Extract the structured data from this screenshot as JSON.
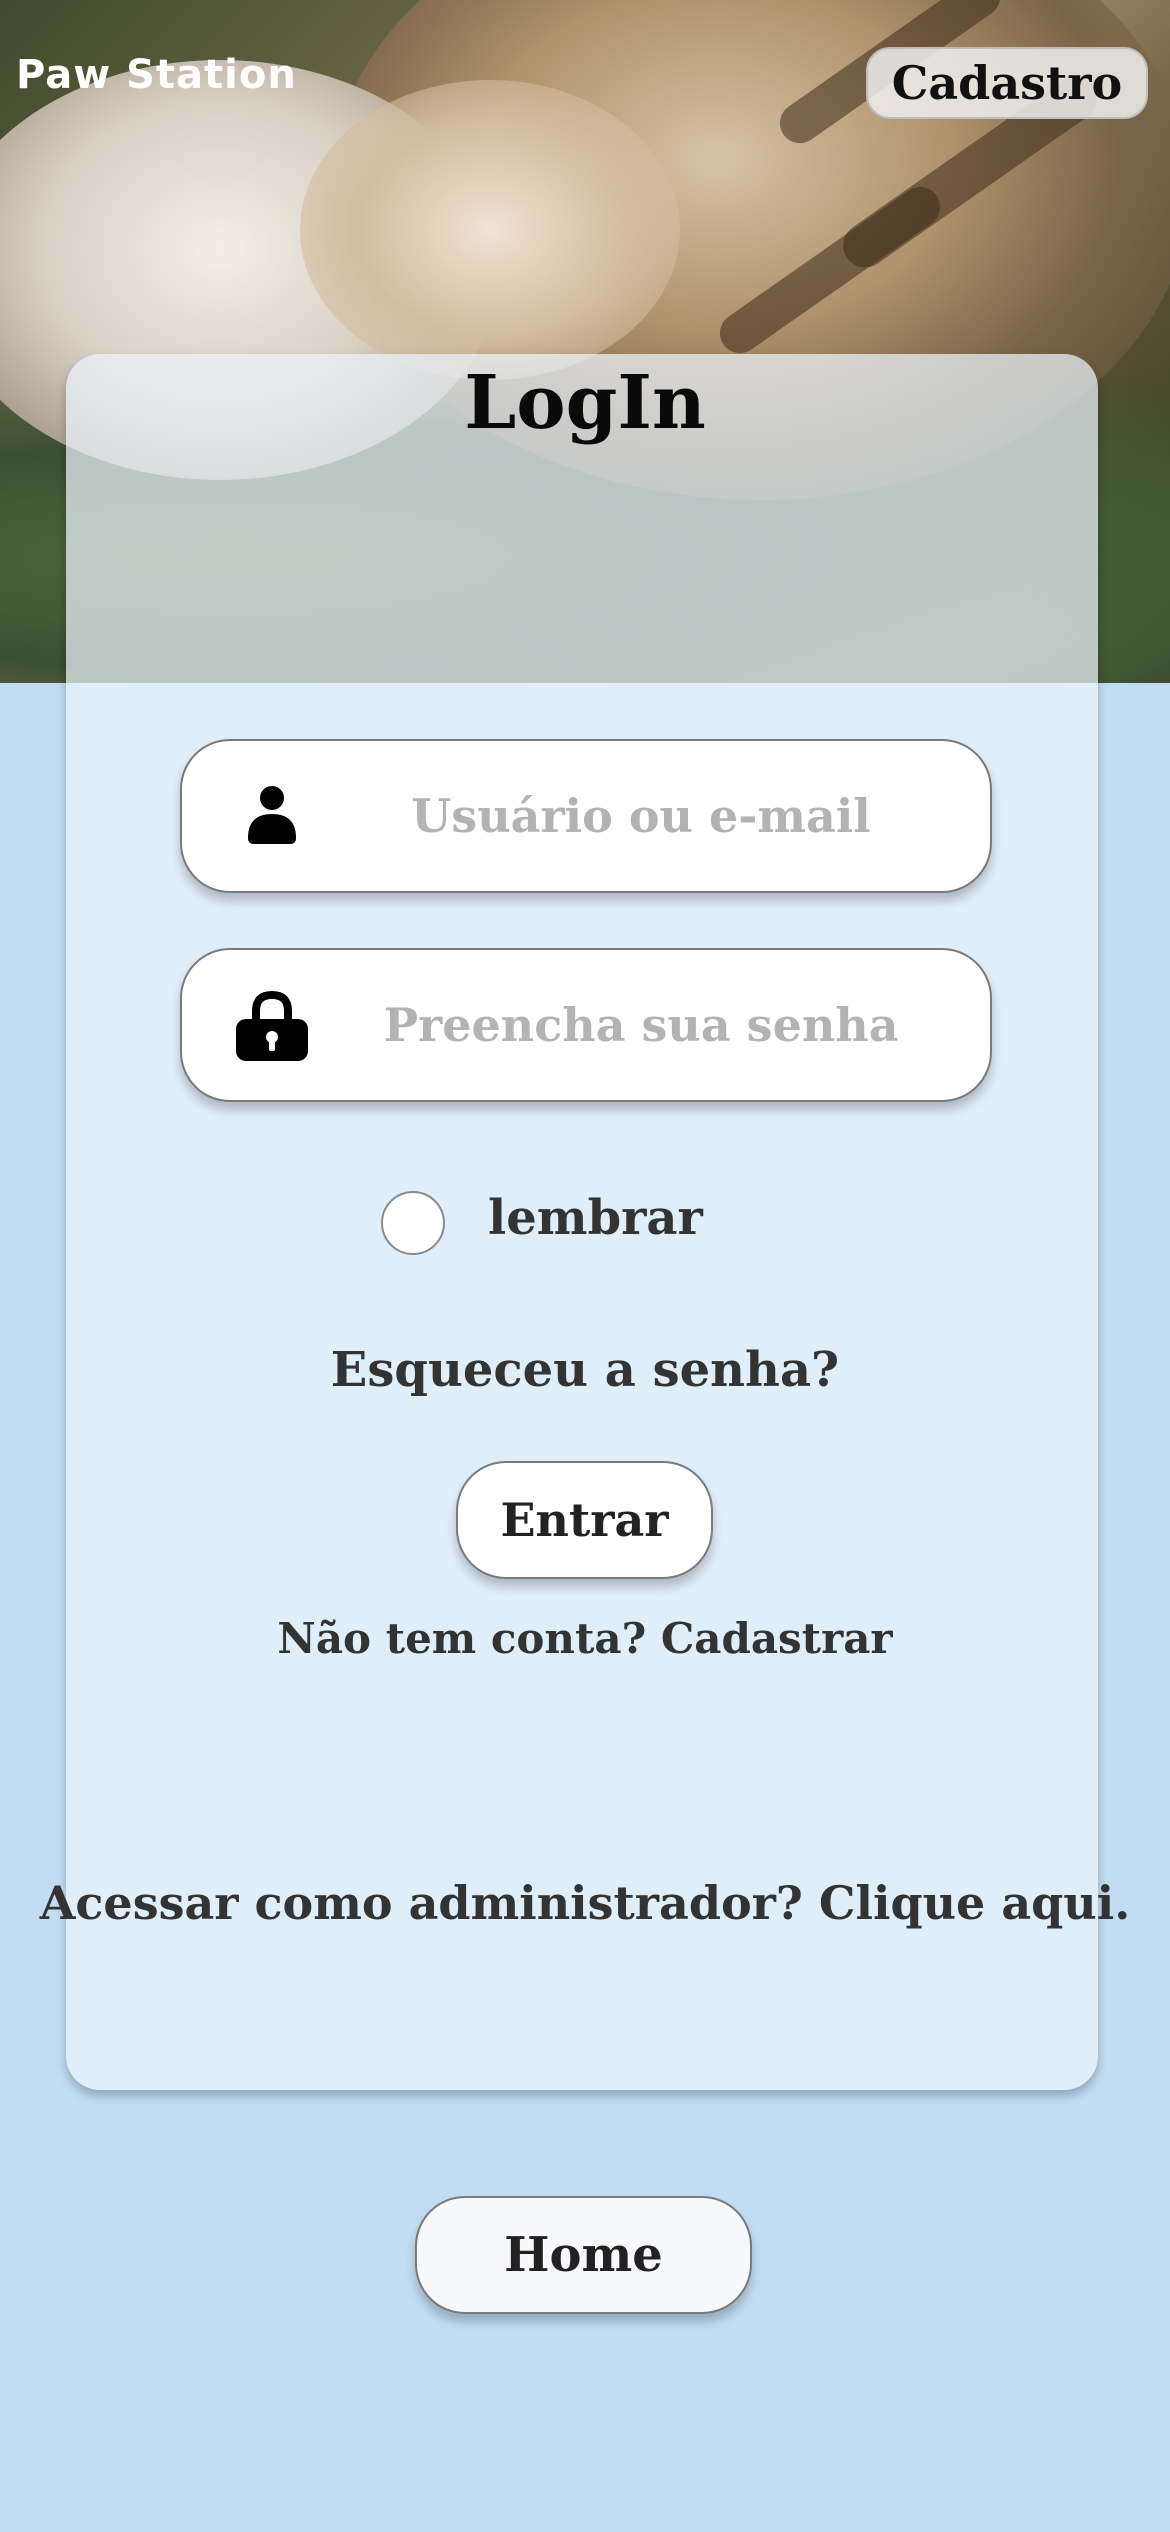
{
  "header": {
    "brand": "Paw Station",
    "signup_label": "Cadastro"
  },
  "login": {
    "title": "LogIn",
    "username_placeholder": "Usuário ou e-mail",
    "password_placeholder": "Preencha sua senha",
    "remember_label": "lembrar",
    "remember_checked": false,
    "forgot_label": "Esqueceu a senha?",
    "submit_label": "Entrar",
    "no_account_label": "Não tem conta? Cadastrar",
    "admin_label": "Acessar como administrador? Clique aqui."
  },
  "footer": {
    "home_label": "Home"
  },
  "icons": {
    "user": "user-icon",
    "lock": "lock-icon"
  },
  "colors": {
    "background": "#c2ddf3",
    "card": "#eaf3fb",
    "placeholder": "#b3b3b3",
    "text": "#333333"
  }
}
